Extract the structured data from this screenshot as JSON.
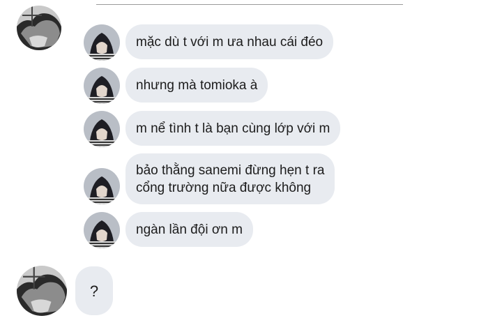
{
  "conversation": {
    "messages": [
      {
        "text": "mặc dù t với m ưa nhau cái đéo"
      },
      {
        "text": "nhưng mà tomioka à"
      },
      {
        "text": "m nể tình t là bạn cùng lớp với m"
      },
      {
        "lines": [
          "bảo thằng sanemi đừng hẹn t ra",
          "cổng trường nữa được không"
        ]
      },
      {
        "text": "ngàn lần đội ơn m"
      }
    ],
    "reply": {
      "text": "?"
    }
  },
  "colors": {
    "bubble_bg": "#e8ebf0",
    "text": "#1c1c1c"
  },
  "icons": {
    "sender_avatar": "dark-haired-character-avatar",
    "receiver_avatar": "grey-haired-character-avatar"
  }
}
